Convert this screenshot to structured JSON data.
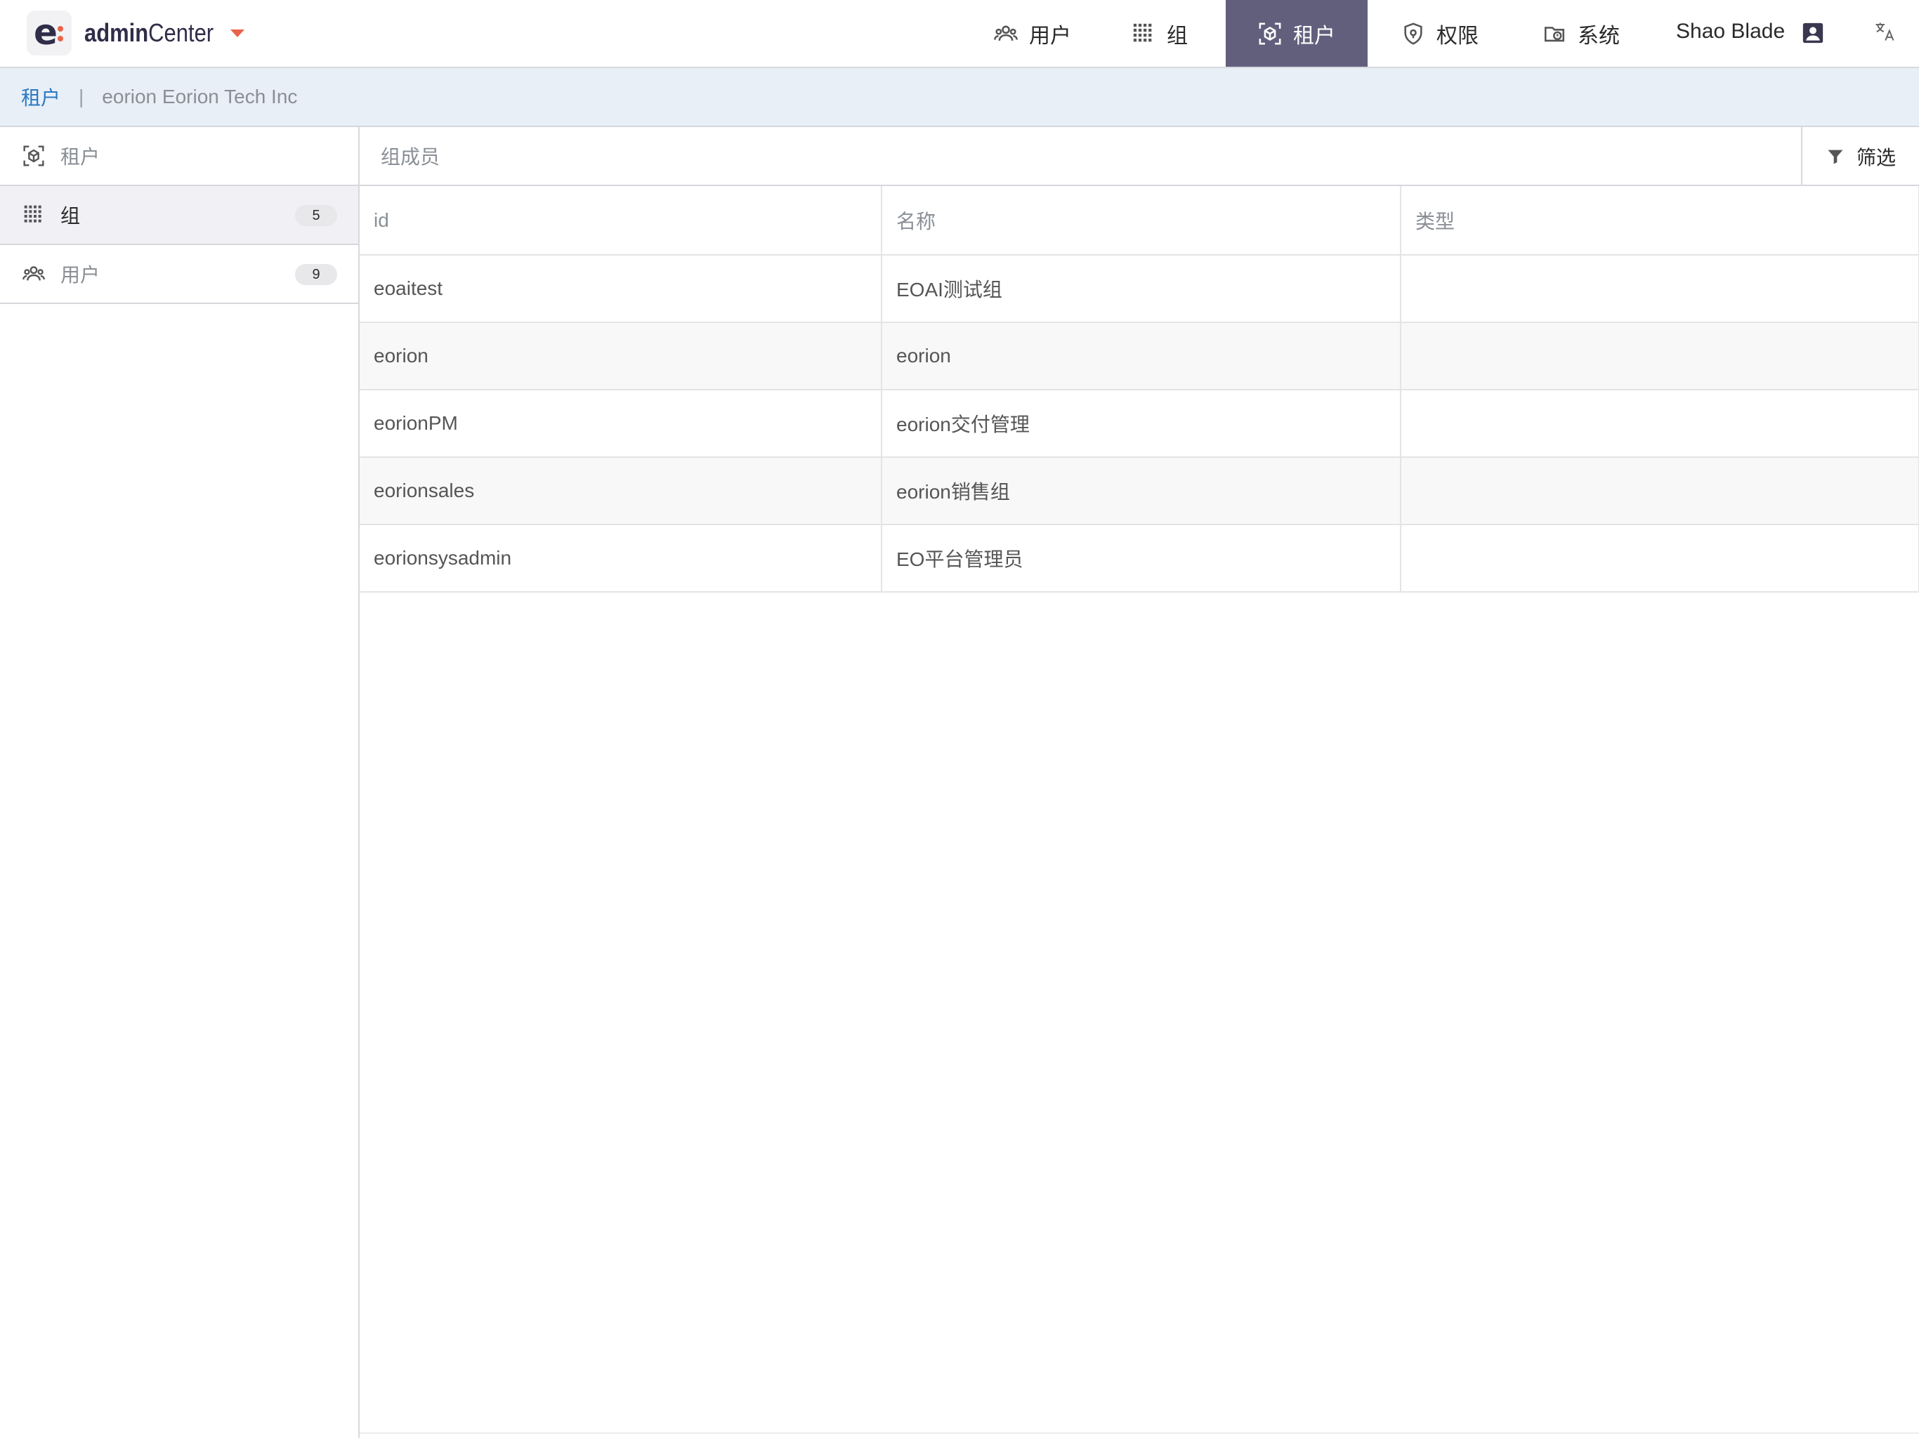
{
  "app": {
    "name_prefix": "admin",
    "name_suffix": "Center",
    "logo_letter": "e"
  },
  "nav": {
    "items": [
      {
        "label": "用户",
        "icon": "users-icon"
      },
      {
        "label": "组",
        "icon": "grid-icon"
      },
      {
        "label": "租户",
        "icon": "tenant-icon",
        "active": true
      },
      {
        "label": "权限",
        "icon": "shield-icon"
      },
      {
        "label": "系统",
        "icon": "system-icon"
      }
    ],
    "user_name": "Shao Blade",
    "user_icon": "user-card-icon",
    "lang_icon": "translate-icon"
  },
  "breadcrumb": {
    "link": "租户",
    "separator": "|",
    "current": "eorion Eorion Tech Inc"
  },
  "sidebar": {
    "header": "租户",
    "items": [
      {
        "label": "组",
        "count": "5",
        "selected": true
      },
      {
        "label": "用户",
        "count": "9",
        "selected": false
      }
    ]
  },
  "main": {
    "title": "组成员",
    "filter_label": "筛选",
    "columns": [
      "id",
      "名称",
      "类型"
    ],
    "rows": [
      [
        "eoaitest",
        "EOAI测试组",
        ""
      ],
      [
        "eorion",
        "eorion",
        ""
      ],
      [
        "eorionPM",
        "eorion交付管理",
        ""
      ],
      [
        "eorionsales",
        "eorion销售组",
        ""
      ],
      [
        "eorionsysadmin",
        "EO平台管理员",
        ""
      ]
    ]
  },
  "colors": {
    "active_nav": "#625f7d",
    "accent": "#e9634a",
    "link": "#2b78c2",
    "crumb_bg": "#e8eff7"
  }
}
